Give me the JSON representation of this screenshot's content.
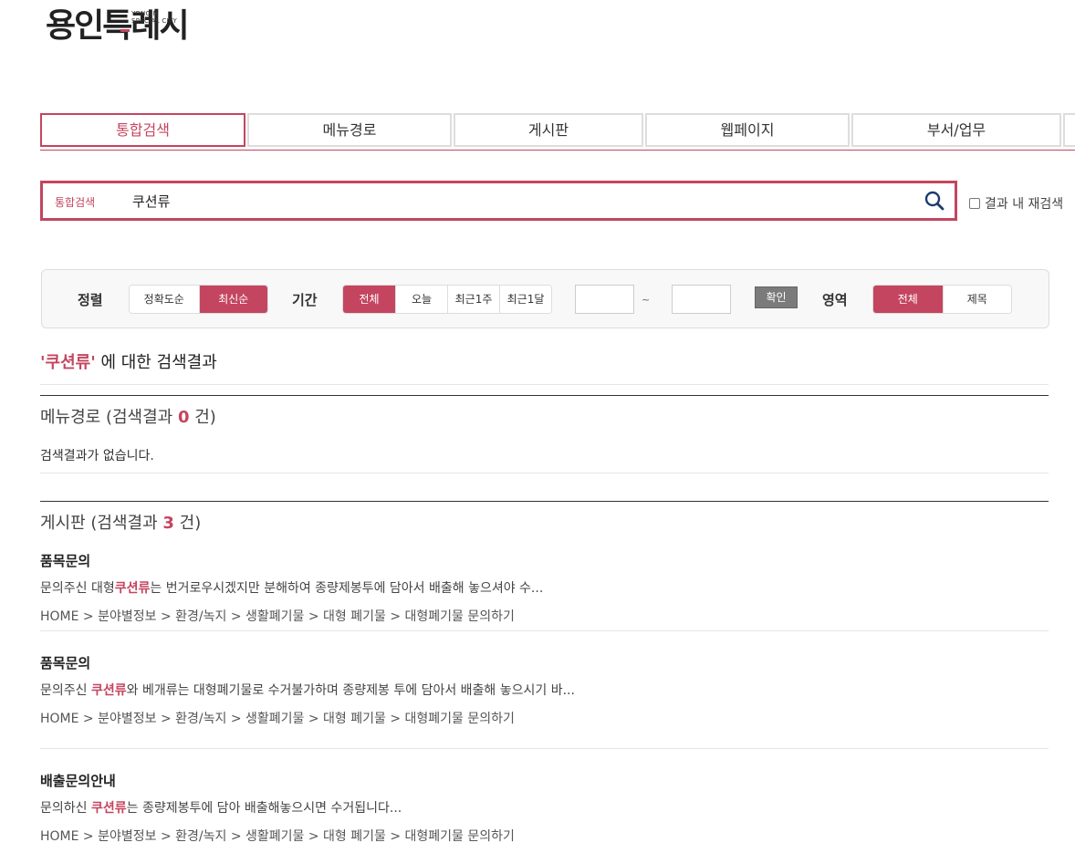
{
  "logo": {
    "main": "용인특례시",
    "sub_line1": "YONGIN",
    "sub_line2": "SPECIAL CITY"
  },
  "tabs": [
    {
      "label": "통합검색",
      "active": true
    },
    {
      "label": "메뉴경로",
      "active": false
    },
    {
      "label": "게시판",
      "active": false
    },
    {
      "label": "웹페이지",
      "active": false
    },
    {
      "label": "부서/업무",
      "active": false
    }
  ],
  "search": {
    "label": "통합검색",
    "value": "쿠션류",
    "research_label": "결과 내 재검색"
  },
  "filter": {
    "sort_label": "정렬",
    "sort_options": [
      "정확도순",
      "최신순"
    ],
    "sort_selected": "최신순",
    "period_label": "기간",
    "period_options": [
      "전체",
      "오늘",
      "최근1주",
      "최근1달"
    ],
    "period_selected": "전체",
    "tilde": "~",
    "confirm_label": "확인",
    "area_label": "영역",
    "area_options": [
      "전체",
      "제목"
    ],
    "area_selected": "전체"
  },
  "result_header": {
    "quote_open": "'",
    "keyword": "쿠션류",
    "quote_close": "'",
    "suffix": " 에 대한 검색결과"
  },
  "menu_section": {
    "title": "메뉴경로",
    "prefix": " (검색결과 ",
    "count": "0",
    "suffix": " 건)",
    "empty_message": "검색결과가 없습니다."
  },
  "board_section": {
    "title": "게시판",
    "prefix": " (검색결과 ",
    "count": "3",
    "suffix": " 건)",
    "items": [
      {
        "title": "품목문의",
        "snippet_before": "문의주신 대형",
        "snippet_highlight": "쿠션류",
        "snippet_after": "는 번거로우시겠지만 분해하여 종량제봉투에 담아서 배출해 놓으셔야 수...",
        "path": "HOME > 분야별정보 > 환경/녹지 > 생활폐기물 > 대형 폐기물 > 대형폐기물 문의하기"
      },
      {
        "title": "품목문의",
        "snippet_before": "문의주신 ",
        "snippet_highlight": "쿠션류",
        "snippet_after": "와 베개류는 대형폐기물로 수거불가하며 종량제봉 투에 담아서 배출해 놓으시기 바...",
        "path": "HOME > 분야별정보 > 환경/녹지 > 생활폐기물 > 대형 폐기물 > 대형폐기물 문의하기"
      },
      {
        "title": "배출문의안내",
        "snippet_before": "문의하신 ",
        "snippet_highlight": "쿠션류",
        "snippet_after": "는 종량제봉투에 담아 배출해놓으시면 수거됩니다...",
        "path": "HOME > 분야별정보 > 환경/녹지 > 생활폐기물 > 대형 폐기물 > 대형폐기물 문의하기"
      }
    ]
  },
  "colors": {
    "accent": "#c4455f",
    "confirm_button": "#7b7b7b"
  },
  "icons": {
    "search": "search-icon"
  }
}
